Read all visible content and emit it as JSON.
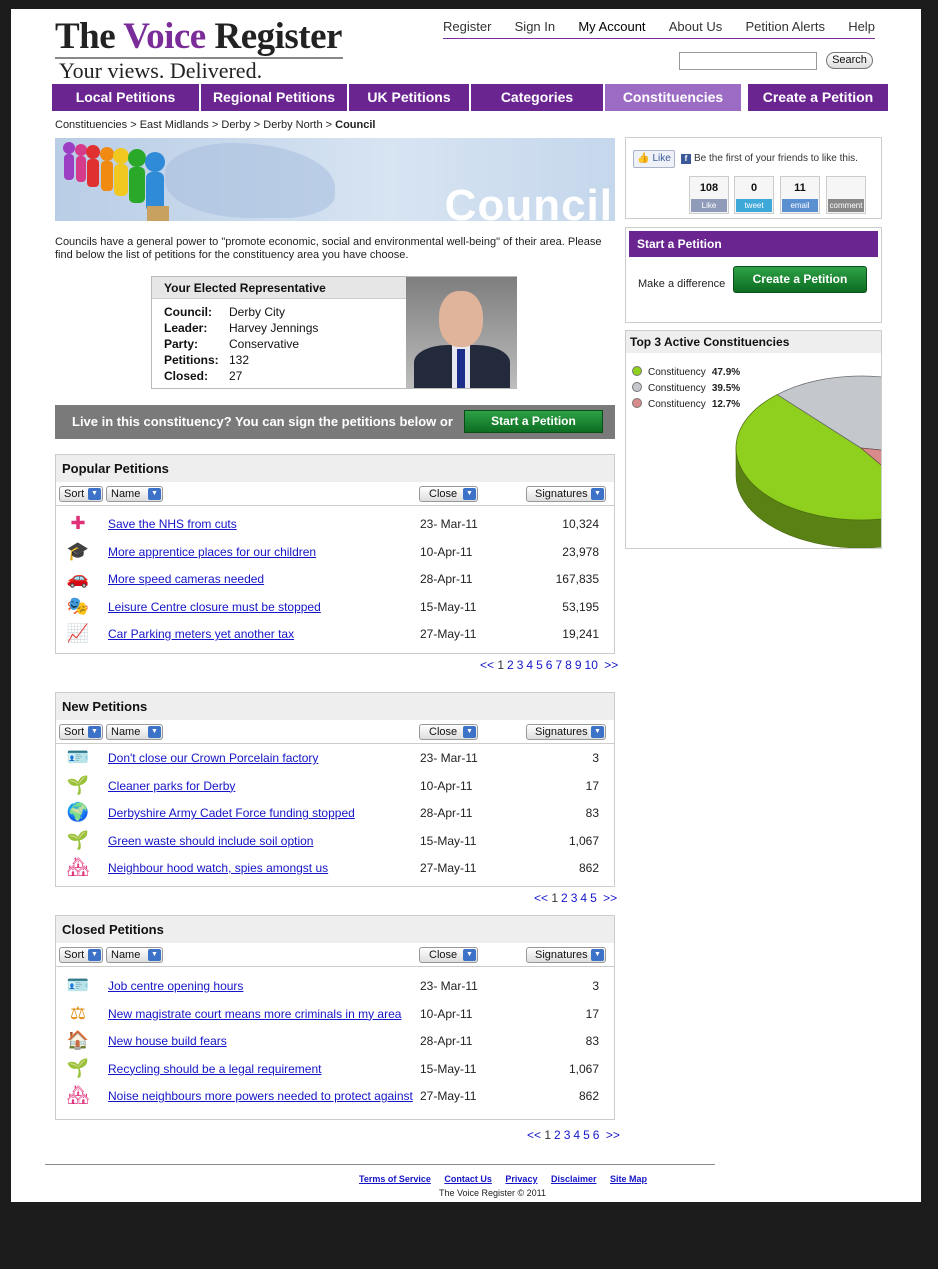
{
  "header": {
    "logo_word_1": "The",
    "logo_word_2": "Voice",
    "logo_word_3": "Register",
    "tagline": "Your views. Delivered.",
    "top_links": [
      "Register",
      "Sign In",
      "My Account",
      "About Us",
      "Petition Alerts",
      "Help"
    ],
    "search_button": "Search",
    "search_value": ""
  },
  "main_nav": [
    "Local Petitions",
    "Regional Petitions",
    "UK Petitions",
    "Categories",
    "Constituencies",
    "Create a Petition"
  ],
  "breadcrumb": {
    "crumbs": [
      "Constituencies",
      "East Midlands",
      "Derby",
      "Derby North"
    ],
    "separator": ">",
    "current": "Council"
  },
  "banner": {
    "text": "Council"
  },
  "intro": "Councils have a general power to \"promote economic, social and environmental well-being\" of their area. Please find below the list of petitions for the constituency area you have choose.",
  "representative": {
    "title": "Your Elected Representative",
    "rows": [
      {
        "k": "Council:",
        "v": "Derby City"
      },
      {
        "k": "Leader:",
        "v": "Harvey Jennings"
      },
      {
        "k": "Party:",
        "v": "Conservative"
      },
      {
        "k": "Petitions:",
        "v": "132"
      },
      {
        "k": "Closed:",
        "v": "27"
      }
    ]
  },
  "live_bar": {
    "text": "Live in this constituency?  You can sign the petitions below or",
    "button": "Start a Petition"
  },
  "controls": {
    "sort": "Sort",
    "name": "Name",
    "close": "Close",
    "signatures": "Signatures"
  },
  "popular": {
    "title": "Popular Petitions",
    "rows": [
      {
        "icon": "health-cross-icon",
        "glyph": "✚",
        "color": "#e0307a",
        "name": "Save the NHS from cuts",
        "date": "23- Mar-11",
        "sig": "10,324"
      },
      {
        "icon": "graduation-cap-icon",
        "glyph": "🎓",
        "color": "#8a52c4",
        "name": "More apprentice places for our children",
        "date": "10-Apr-11",
        "sig": "23,978"
      },
      {
        "icon": "car-icon",
        "glyph": "🚗",
        "color": "#d62020",
        "name": "More speed cameras needed",
        "date": "28-Apr-11",
        "sig": "167,835"
      },
      {
        "icon": "theatre-masks-icon",
        "glyph": "🎭",
        "color": "#d06fc8",
        "name": "Leisure Centre closure must be stopped",
        "date": "15-May-11",
        "sig": "53,195"
      },
      {
        "icon": "rising-chart-icon",
        "glyph": "📈",
        "color": "#3a3aa0",
        "name": "Car Parking meters yet another tax",
        "date": "27-May-11",
        "sig": "19,241"
      }
    ],
    "pager": {
      "prev": "<<",
      "pages": [
        "1",
        "2",
        "3",
        "4",
        "5",
        "6",
        "7",
        "8",
        "9",
        "10"
      ],
      "next": ">>"
    }
  },
  "new": {
    "title": "New Petitions",
    "rows": [
      {
        "icon": "id-card-icon",
        "glyph": "🪪",
        "color": "#8a52c4",
        "name": "Don't close our Crown Porcelain factory",
        "date": "23- Mar-11",
        "sig": "3"
      },
      {
        "icon": "plant-icon",
        "glyph": "🌱",
        "color": "#2a9d3a",
        "name": "Cleaner parks for Derby",
        "date": "10-Apr-11",
        "sig": "17"
      },
      {
        "icon": "globe-icon",
        "glyph": "🌍",
        "color": "#a01a2a",
        "name": "Derbyshire Army Cadet Force funding stopped",
        "date": "28-Apr-11",
        "sig": "83"
      },
      {
        "icon": "plant-icon",
        "glyph": "🌱",
        "color": "#2a9d3a",
        "name": "Green waste should include soil option",
        "date": "15-May-11",
        "sig": "1,067"
      },
      {
        "icon": "neighbourhood-houses-icon",
        "glyph": "🏘",
        "color": "#e0307a",
        "name": "Neighbour hood watch, spies amongst us",
        "date": "27-May-11",
        "sig": "862"
      }
    ],
    "pager": {
      "prev": "<<",
      "pages": [
        "1",
        "2",
        "3",
        "4",
        "5"
      ],
      "next": ">>"
    }
  },
  "closed": {
    "title": "Closed Petitions",
    "rows": [
      {
        "icon": "id-card-icon",
        "glyph": "🪪",
        "color": "#8a52c4",
        "name": "Job centre opening hours",
        "date": "23- Mar-11",
        "sig": "3"
      },
      {
        "icon": "scales-icon",
        "glyph": "⚖",
        "color": "#e08a10",
        "name": "New magistrate court means more criminals in my area",
        "date": "10-Apr-11",
        "sig": "17"
      },
      {
        "icon": "house-icon",
        "glyph": "🏠",
        "color": "#d62020",
        "name": "New house build fears",
        "date": "28-Apr-11",
        "sig": "83"
      },
      {
        "icon": "plant-icon",
        "glyph": "🌱",
        "color": "#2a9d3a",
        "name": "Recycling should be a legal requirement",
        "date": "15-May-11",
        "sig": "1,067"
      },
      {
        "icon": "neighbourhood-houses-icon",
        "glyph": "🏘",
        "color": "#e0307a",
        "name": "Noise neighbours more powers needed to protect against",
        "date": "27-May-11",
        "sig": "862"
      }
    ],
    "pager": {
      "prev": "<<",
      "pages": [
        "1",
        "2",
        "3",
        "4",
        "5",
        "6"
      ],
      "next": ">>"
    }
  },
  "social": {
    "like_button": "Like",
    "like_text": "Be the first of your friends to like this.",
    "fb_letter": "f",
    "counters": [
      {
        "num": "108",
        "label": "Like",
        "color": "#8f9bb8"
      },
      {
        "num": "0",
        "label": "tweet",
        "color": "#3ea8d8"
      },
      {
        "num": "11",
        "label": "email",
        "color": "#5a8fd0"
      },
      {
        "num": "",
        "label": "comment",
        "color": "#888888"
      }
    ]
  },
  "start_box": {
    "title": "Start a Petition",
    "text": "Make a difference",
    "button": "Create a Petition"
  },
  "chart_data": {
    "type": "pie",
    "title": "Top 3 Active Constituencies",
    "categories": [
      "Constituency",
      "Constituency",
      "Constituency"
    ],
    "values": [
      47.9,
      39.5,
      12.7
    ],
    "labels": [
      "47.9%",
      "39.5%",
      "12.7%"
    ],
    "colors": [
      "#8fd01e",
      "#c4c7cb",
      "#d98a8a"
    ],
    "legend": "top-left"
  },
  "footer": {
    "links": [
      "Terms of Service",
      "Contact Us",
      "Privacy",
      "Disclaimer",
      "Site Map"
    ],
    "copyright": "The Voice Register © 2011"
  }
}
